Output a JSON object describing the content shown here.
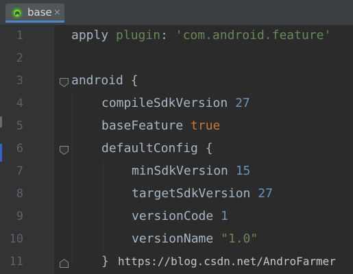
{
  "tab": {
    "label": "base",
    "close_symbol": "×",
    "icon": "gradle-elephant-icon"
  },
  "code_lines": [
    {
      "number": "1",
      "tokens": [
        {
          "text": "apply ",
          "kind": "plain"
        },
        {
          "text": "plugin",
          "kind": "plugin"
        },
        {
          "text": ": ",
          "kind": "plain"
        },
        {
          "text": "'com.android.feature'",
          "kind": "string"
        }
      ]
    },
    {
      "number": "2",
      "tokens": []
    },
    {
      "number": "3",
      "tokens": [
        {
          "text": "android {",
          "kind": "plain"
        }
      ]
    },
    {
      "number": "4",
      "tokens": [
        {
          "text": "compileSdkVersion ",
          "kind": "plain"
        },
        {
          "text": "27",
          "kind": "number"
        }
      ]
    },
    {
      "number": "5",
      "tokens": [
        {
          "text": "baseFeature ",
          "kind": "plain"
        },
        {
          "text": "true",
          "kind": "boolean"
        }
      ]
    },
    {
      "number": "6",
      "tokens": [
        {
          "text": "defaultConfig {",
          "kind": "plain"
        }
      ]
    },
    {
      "number": "7",
      "tokens": [
        {
          "text": "minSdkVersion ",
          "kind": "plain"
        },
        {
          "text": "15",
          "kind": "number"
        }
      ]
    },
    {
      "number": "8",
      "tokens": [
        {
          "text": "targetSdkVersion ",
          "kind": "plain"
        },
        {
          "text": "27",
          "kind": "number"
        }
      ]
    },
    {
      "number": "9",
      "tokens": [
        {
          "text": "versionCode ",
          "kind": "plain"
        },
        {
          "text": "1",
          "kind": "number"
        }
      ]
    },
    {
      "number": "10",
      "tokens": [
        {
          "text": "versionName ",
          "kind": "plain"
        },
        {
          "text": "\"1.0\"",
          "kind": "string"
        }
      ]
    },
    {
      "number": "11",
      "tokens": [
        {
          "text": "}",
          "kind": "plain"
        }
      ]
    }
  ],
  "watermark": "https://blog.csdn.net/AndroFarmer",
  "colors": {
    "background": "#2b2b2b",
    "gutter": "#313335",
    "line_number": "#606366",
    "plain": "#a9b7c6",
    "plugin": "#6a8759",
    "string": "#6a8759",
    "number": "#6897bb",
    "boolean": "#cc7832",
    "tab_underline": "#4a88c7"
  }
}
